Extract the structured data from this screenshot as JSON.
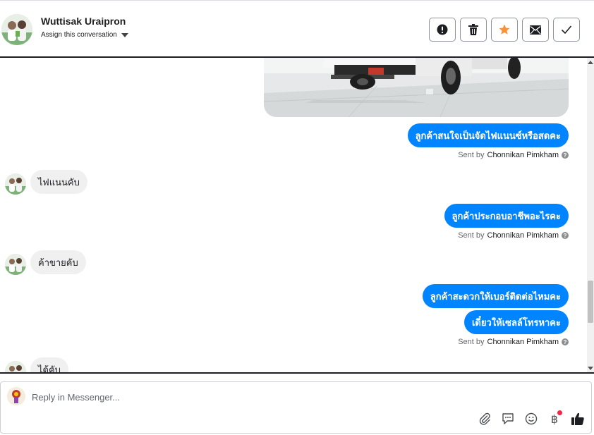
{
  "header": {
    "name": "Wuttisak Uraipron",
    "assign_label": "Assign this conversation",
    "actions": [
      {
        "id": "spam",
        "icon": "alert-icon"
      },
      {
        "id": "delete",
        "icon": "trash-icon"
      },
      {
        "id": "star",
        "icon": "star-icon",
        "color": "#f7923b"
      },
      {
        "id": "email",
        "icon": "envelope-icon"
      },
      {
        "id": "done",
        "icon": "checkmark-icon"
      }
    ]
  },
  "messages": {
    "out_1": "ลูกค้าสนใจเป็นจัดไฟแนนซ์หรือสดคะ",
    "sent_1": {
      "prefix": "Sent by",
      "agent": "Chonnikan Pimkham"
    },
    "in_1": "ไฟแนนคับ",
    "out_2": "ลูกค้าประกอบอาชีพอะไรคะ",
    "sent_2": {
      "prefix": "Sent by",
      "agent": "Chonnikan Pimkham"
    },
    "in_2": "ค้าขายคับ",
    "out_3": "ลูกค้าสะดวกให้เบอร์ติดต่อไหมคะ",
    "out_4": "เดี๋ยวให้เซลล์โทรหาคะ",
    "sent_3": {
      "prefix": "Sent by",
      "agent": "Chonnikan Pimkham"
    },
    "in_3": "ได้คับ"
  },
  "composer": {
    "placeholder": "Reply in Messenger...",
    "tools": [
      "paperclip-icon",
      "saved-reply-icon",
      "emoji-icon",
      "baht-icon",
      "thumbs-up-icon"
    ],
    "baht_symbol": "฿"
  },
  "colors": {
    "outgoing_bubble": "#0084ff",
    "incoming_bubble": "#f0f0f0",
    "star": "#f7923b",
    "notification_dot": "#f02849"
  }
}
